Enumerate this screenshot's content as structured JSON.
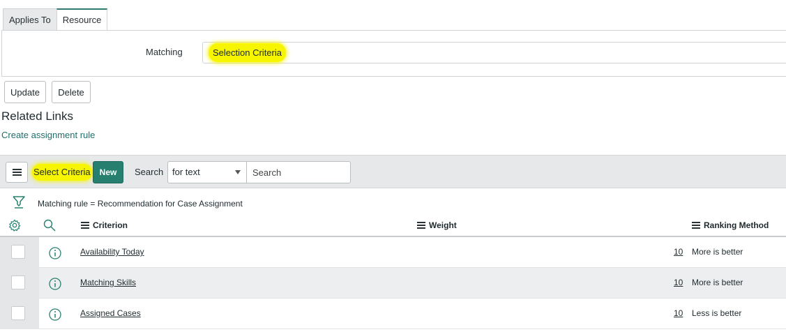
{
  "tabs": [
    {
      "label": "Applies To"
    },
    {
      "label": "Resource"
    }
  ],
  "form": {
    "matching_label": "Matching",
    "matching_value": "Selection Criteria",
    "highlight_color": "#f7f500"
  },
  "actions": {
    "update_label": "Update",
    "delete_label": "Delete"
  },
  "related": {
    "title": "Related Links",
    "link": "Create assignment rule"
  },
  "list": {
    "title": "Select Criteria",
    "new_label": "New",
    "search_label": "Search",
    "search_field": "for text",
    "search_placeholder": "Search",
    "accent_color": "#27806f",
    "breadcrumb": "Matching rule = Recommendation for Case Assignment",
    "columns": {
      "criterion": "Criterion",
      "weight": "Weight",
      "ranking": "Ranking Method"
    },
    "rows": [
      {
        "criterion": "Availability Today",
        "weight": "10",
        "ranking": "More is better"
      },
      {
        "criterion": "Matching Skills",
        "weight": "10",
        "ranking": "More is better"
      },
      {
        "criterion": "Assigned Cases",
        "weight": "10",
        "ranking": "Less is better"
      }
    ]
  },
  "icons": {
    "menu": "hamburger-menu-icon",
    "filter": "funnel-filter-icon",
    "settings": "gear-icon",
    "search": "magnifier-icon",
    "info": "info-circle-icon",
    "dropdown": "caret-down-icon"
  }
}
